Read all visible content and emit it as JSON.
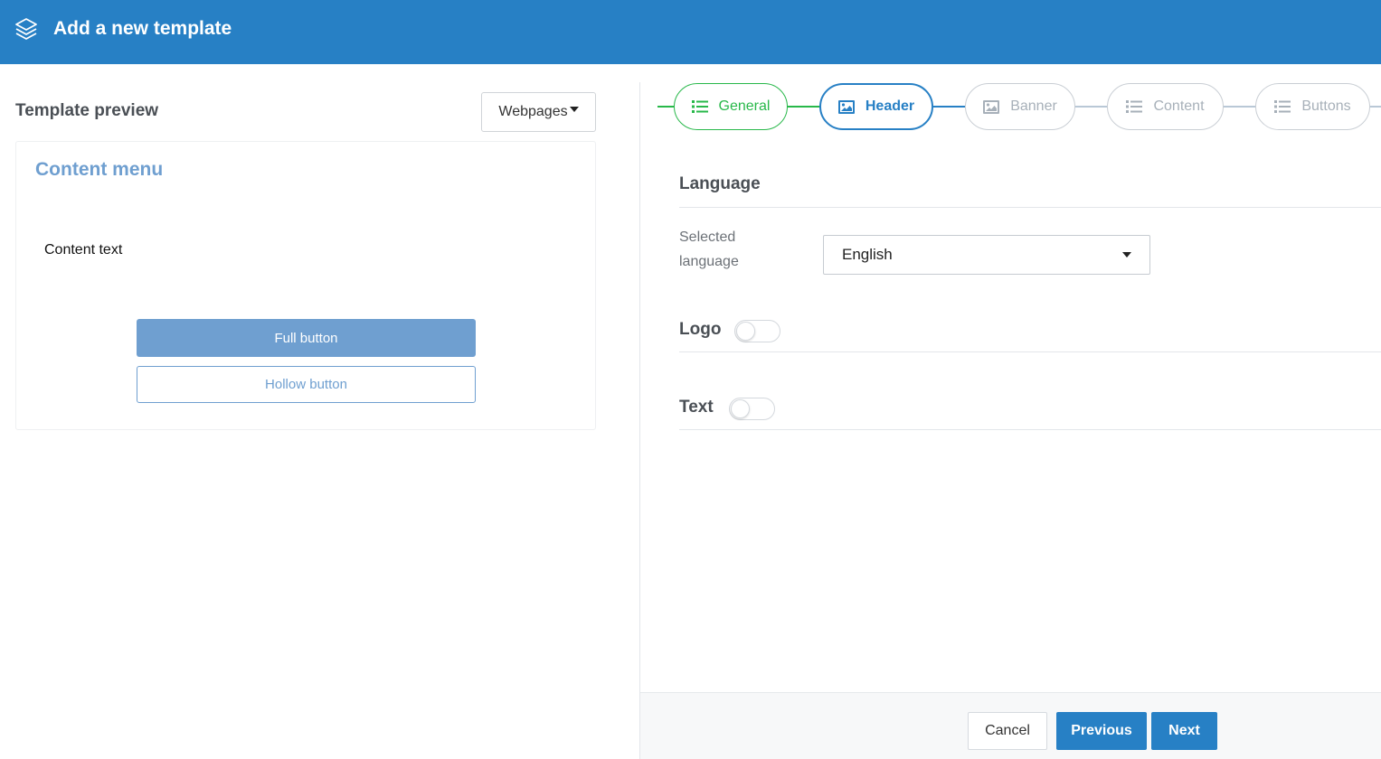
{
  "header": {
    "title": "Add a new template",
    "icon": "layers-icon",
    "background": "#2780c5"
  },
  "preview": {
    "title": "Template preview",
    "dropdown_label": "Webpages",
    "content_menu": "Content menu",
    "content_text": "Content text",
    "full_button": "Full button",
    "hollow_button": "Hollow button",
    "accent_color": "#6f9fd0"
  },
  "stepper": {
    "steps": [
      {
        "label": "General",
        "icon": "list-icon",
        "state": "done"
      },
      {
        "label": "Header",
        "icon": "image-icon",
        "state": "active"
      },
      {
        "label": "Banner",
        "icon": "image-icon",
        "state": "todo"
      },
      {
        "label": "Content",
        "icon": "list-icon",
        "state": "todo"
      },
      {
        "label": "Buttons",
        "icon": "list-icon",
        "state": "todo"
      }
    ],
    "colors": {
      "done": "#28b84a",
      "active": "#2780c5",
      "todo": "#a7b0b9"
    }
  },
  "form": {
    "language_section": "Language",
    "selected_language_label": "Selected language",
    "selected_language_value": "English",
    "logo_section": "Logo",
    "logo_enabled": false,
    "text_section": "Text",
    "text_enabled": false
  },
  "footer": {
    "cancel": "Cancel",
    "previous": "Previous",
    "next": "Next"
  }
}
